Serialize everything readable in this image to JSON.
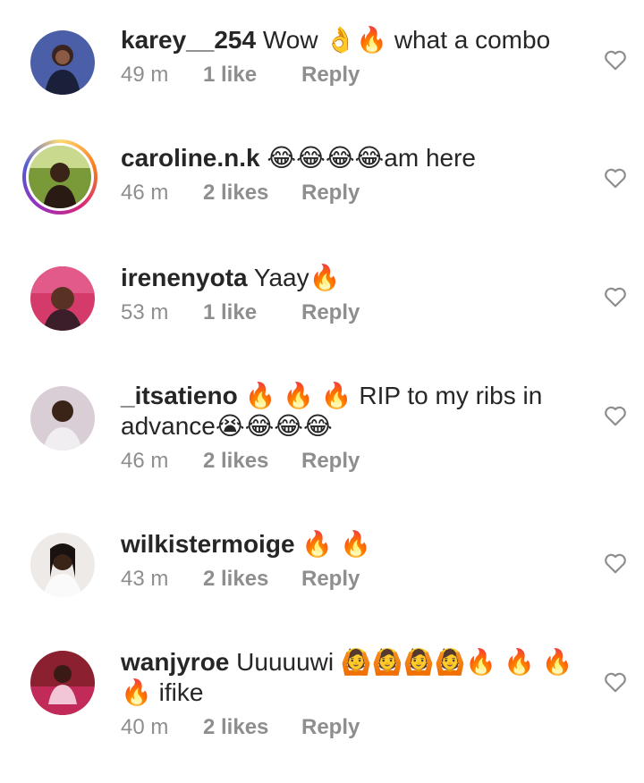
{
  "comments": [
    {
      "username": "karey__254",
      "text": "Wow 👌🔥 what a combo",
      "time": "49 m",
      "likes": "1 like",
      "reply": "Reply",
      "colors": {
        "avatar": "#5a6fb0"
      }
    },
    {
      "username": "caroline.n.k",
      "text": "😂😂😂😂am here",
      "time": "46 m",
      "likes": "2 likes",
      "reply": "Reply",
      "colors": {
        "avatar": "#7a9a3a"
      }
    },
    {
      "username": "irenenyota",
      "text": "Yaay🔥",
      "time": "53 m",
      "likes": "1 like",
      "reply": "Reply",
      "colors": {
        "avatar": "#d43a6a"
      }
    },
    {
      "username": "_itsatieno",
      "text_line1": "🔥 🔥 🔥 RIP to my ribs in",
      "text_line2": "advance😭😂😂😂",
      "time": "46 m",
      "likes": "2 likes",
      "reply": "Reply",
      "colors": {
        "avatar": "#c8b8c4"
      }
    },
    {
      "username": "wilkistermoige",
      "text": "🔥 🔥",
      "time": "43 m",
      "likes": "2 likes",
      "reply": "Reply",
      "colors": {
        "avatar": "#e7e2df"
      }
    },
    {
      "username": "wanjyroe",
      "text_line1": "Uuuuuwi 🙆🙆🙆🙆🔥 🔥 🔥",
      "text_line2": "🔥 ifike",
      "time": "40 m",
      "likes": "2 likes",
      "reply": "Reply",
      "colors": {
        "avatar": "#8a2030"
      }
    }
  ],
  "icons": {
    "like": "heart-outline-icon",
    "fire": "fire-emoji",
    "laugh": "tears-of-joy-emoji"
  }
}
